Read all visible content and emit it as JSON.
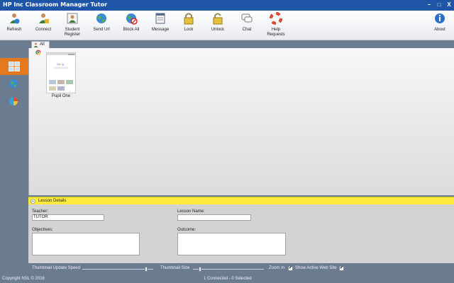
{
  "window": {
    "title": "HP Inc Classroom Manager Tutor",
    "minimize": "–",
    "maximize": "□",
    "close": "X"
  },
  "toolbar": {
    "refresh": "Refresh",
    "connect": "Connect",
    "student_register": "Student Register",
    "send_url": "Send Url",
    "block_all": "Block All",
    "message": "Message",
    "lock": "Lock",
    "unlock": "Unlock",
    "chat": "Chat",
    "help_requests": "Help Requests",
    "about": "About"
  },
  "tabs": {
    "all": "All"
  },
  "pupils": [
    {
      "name": "Pupil One"
    }
  ],
  "lesson": {
    "header": "Lesson Details",
    "teacher_label": "Teacher:",
    "teacher_value": "TUTOR",
    "lesson_name_label": "Lesson Name:",
    "lesson_name_value": "",
    "objectives_label": "Objectives:",
    "outcome_label": "Outcome:"
  },
  "controls": {
    "thumbnail_speed": "Thumbnail Update Speed",
    "thumbnail_size": "Thumbnail Size",
    "zoom_in": "Zoom In",
    "show_active": "Show Active Web Site",
    "zoom_in_checked": true,
    "show_active_checked": true
  },
  "status": {
    "copyright": "Copyright NSL © 2016",
    "connections": "1 Connected - 0 Selected"
  },
  "icons": {
    "refresh": "refresh-icon",
    "connect": "connect-icon",
    "student_register": "register-icon",
    "send_url": "globe-icon",
    "block_all": "block-globe-icon",
    "message": "message-icon",
    "lock": "lock-icon",
    "unlock": "unlock-icon",
    "chat": "chat-icon",
    "help_requests": "lifebuoy-icon",
    "about": "info-icon"
  },
  "colors": {
    "titlebar": "#1f55a6",
    "active_nav": "#e47a1d",
    "lesson_header": "#fbe93d",
    "chrome": "#6c7c90"
  }
}
